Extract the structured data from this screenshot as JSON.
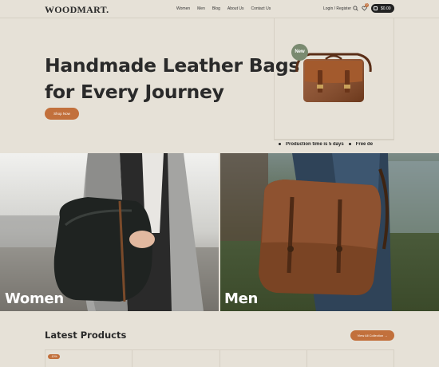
{
  "header": {
    "logo": "WOODMART.",
    "nav": [
      "Women",
      "Men",
      "Blog",
      "About Us",
      "Contact Us"
    ],
    "login": "Login / Register",
    "wishlist_count": "0",
    "cart_total": "$0.00"
  },
  "hero": {
    "title_line1": "Handmade Leather Bags",
    "title_line2": "for Every Journey",
    "button": "Shop Now",
    "badge": "New",
    "ticker": [
      "Production time is 5 days",
      "Free de"
    ]
  },
  "categories": [
    {
      "label": "Women"
    },
    {
      "label": "Men"
    }
  ],
  "latest": {
    "title": "Latest Products",
    "button": "View All Collection →",
    "sale_badge": "-10%"
  },
  "colors": {
    "background": "#e6e1d7",
    "accent": "#c2703c",
    "badge_green": "#7a8a70",
    "dark": "#222222"
  }
}
